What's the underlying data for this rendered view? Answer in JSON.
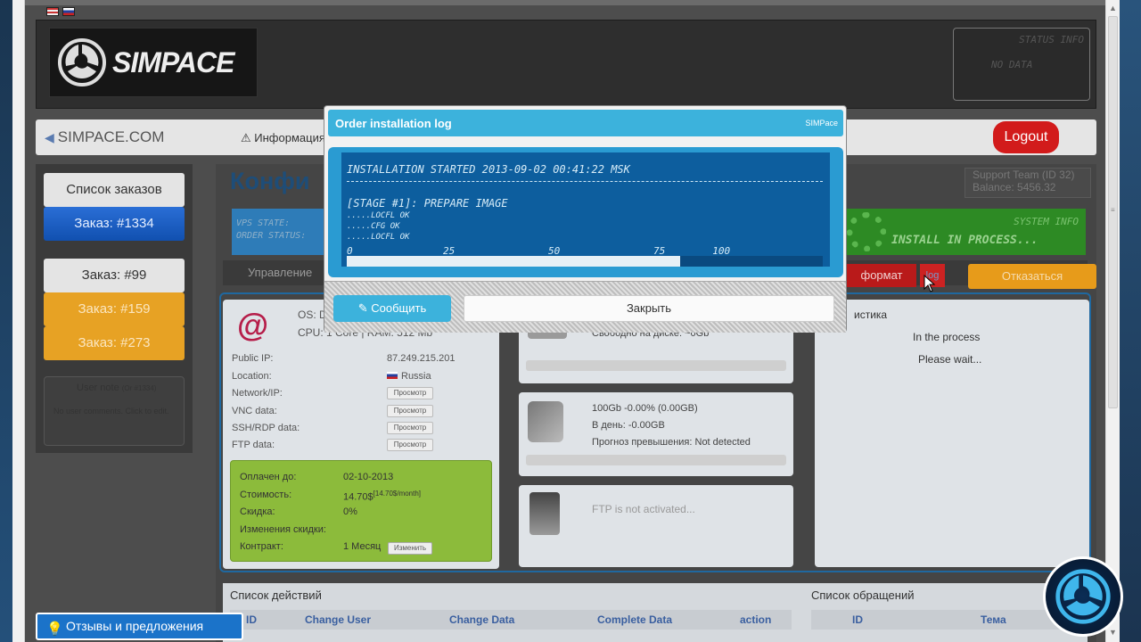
{
  "header": {
    "logo_text": "SIMPACE",
    "status_title": "STATUS INFO",
    "status_value": "NO DATA"
  },
  "nav": {
    "site": "SIMPACE.COM",
    "info": "Информация",
    "logout": "Logout"
  },
  "sidebar": {
    "order_list": "Список заказов",
    "orders": [
      "Заказ: #1334",
      "Заказ: #99",
      "Заказ: #159",
      "Заказ: #273"
    ],
    "note_title": "User note",
    "note_sup": "(Or #1334)",
    "note_text": "No user comments. Click to edit."
  },
  "main": {
    "title": "Конфи",
    "support": [
      "Support Team (ID 32)",
      "Balance: 5456.32"
    ],
    "vps_state": "VPS STATE:",
    "order_status": "ORDER STATUS:",
    "sys_title": "SYSTEM INFO",
    "sys_text": "INSTALL IN PROCESS...",
    "tab_manage": "Управление",
    "tab_format": "формат",
    "tab_log": "log",
    "tab_cancel": "Отказаться"
  },
  "server": {
    "os": "OS: D",
    "cpu": "CPU: 1 Core | RAM: 512 Mb",
    "rows": [
      {
        "k": "Public IP:",
        "v": "87.249.215.201"
      },
      {
        "k": "Location:",
        "v": "Russia"
      },
      {
        "k": "Network/IP:",
        "btn": "Просмотр"
      },
      {
        "k": "VNC data:",
        "btn": "Просмотр"
      },
      {
        "k": "SSH/RDP data:",
        "btn": "Просмотр"
      },
      {
        "k": "FTP data:",
        "btn": "Просмотр"
      }
    ],
    "pay": [
      {
        "k": "Оплачен до:",
        "v": "02-10-2013"
      },
      {
        "k": "Стоимость:",
        "v": "14.70$",
        "sup": "[14.70$/month]"
      },
      {
        "k": "Скидка:",
        "v": "0%"
      },
      {
        "k": "Изменения скидки:",
        "v": ""
      },
      {
        "k": "Контракт:",
        "v": "1 Месяц"
      }
    ],
    "change_btn": "Изменить"
  },
  "disk": {
    "free": "Свободно на диске: ~0Gb"
  },
  "traffic": {
    "line1": "100Gb -0.00% (0.00GB)",
    "line2": "В день: -0.00GB",
    "line3": "Прогноз превышения: Not detected"
  },
  "ftp": {
    "text": "FTP is not activated..."
  },
  "stats": {
    "title": "истика",
    "line1": "In the process",
    "line2": "Please wait..."
  },
  "actions": {
    "title": "Список действий",
    "cols": [
      "ID",
      "Change User",
      "Change Data",
      "Complete Data",
      "action"
    ]
  },
  "tickets": {
    "title": "Список обращений",
    "cols": [
      "ID",
      "Тема"
    ]
  },
  "feedback": "Отзывы и предложения",
  "modal": {
    "title": "Order installation log",
    "brand": "SIMPace",
    "started": "INSTALLATION STARTED 2013-09-02 00:41:22 MSK",
    "stage": "[STAGE #1]: PREPARE IMAGE",
    "steps": [
      ".....LOCFL OK",
      ".....CFG OK",
      ".....LOCFL OK"
    ],
    "scale": [
      "0",
      "25",
      "50",
      "75________100"
    ],
    "progress": 0.7,
    "report": "Сообщить",
    "close": "Закрыть"
  },
  "colors": {
    "accent": "#3cb2dc",
    "danger": "#d21b1b",
    "warning": "#e7a224",
    "success": "#2d8a24"
  }
}
